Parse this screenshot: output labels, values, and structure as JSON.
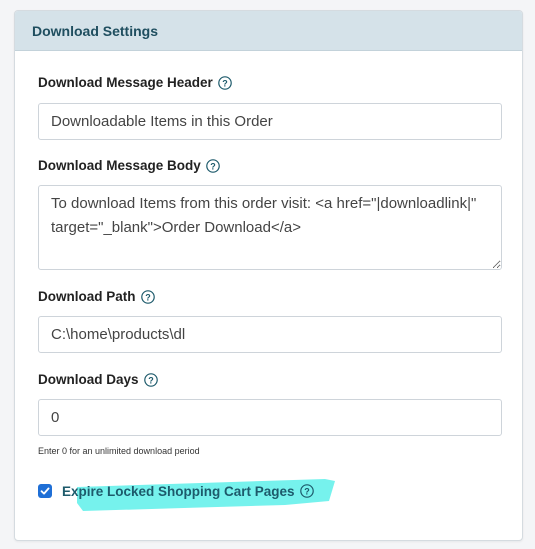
{
  "panel": {
    "title": "Download Settings"
  },
  "fields": {
    "message_header": {
      "label": "Download Message Header",
      "value": "Downloadable Items in this Order"
    },
    "message_body": {
      "label": "Download Message Body",
      "value": "To download Items from this order visit: <a href=\"|downloadlink|\" target=\"_blank\">Order Download</a>"
    },
    "path": {
      "label": "Download Path",
      "value": "C:\\home\\products\\dl"
    },
    "days": {
      "label": "Download Days",
      "value": "0",
      "hint": "Enter 0 for an unlimited download period"
    },
    "expire_locked": {
      "label": "Expire Locked Shopping Cart Pages",
      "checked": true
    }
  },
  "icons": {
    "help": "question-circle-icon",
    "check": "checkmark-icon"
  },
  "colors": {
    "header_bg": "#d5e2e9",
    "header_text": "#1f4e5f",
    "checkbox": "#1f6fd6",
    "highlight": "#5ef0ea"
  }
}
